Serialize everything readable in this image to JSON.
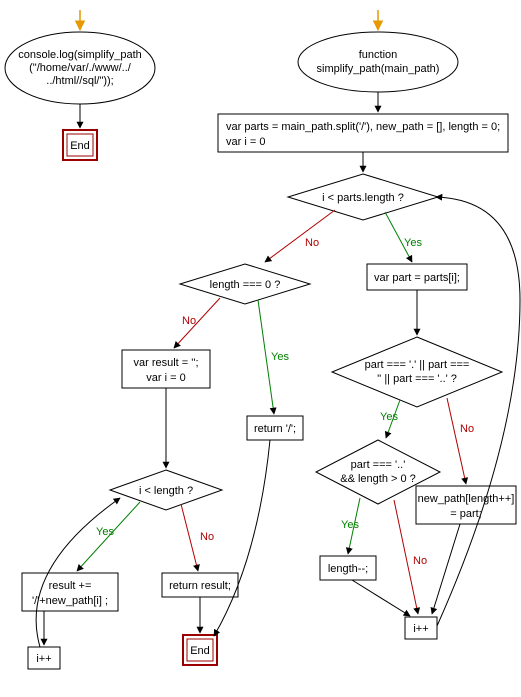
{
  "nodes": {
    "call_ellipse": {
      "line1": "console.log(simplify_path",
      "line2": "(\"/home/var/./www/../",
      "line3": "../html//sql/\"));"
    },
    "end1": "End",
    "func_ellipse": {
      "line1": "function",
      "line2": "simplify_path(main_path)"
    },
    "init_box": {
      "line1": "var parts = main_path.split('/'), new_path = [], length = 0;",
      "line2": "var i = 0"
    },
    "cond_i_parts": "i < parts.length ?",
    "cond_len0": "length === 0 ?",
    "box_part": "var part = parts[i];",
    "cond_part_dots": {
      "line1": "part === '.' || part ===",
      "line2": "'' || part === '..' ?"
    },
    "box_result": {
      "line1": "var result = '';",
      "line2": "var i = 0"
    },
    "ret_slash": "return '/';",
    "cond_part_up": {
      "line1": "part === '..'",
      "line2": "&& length > 0 ?"
    },
    "box_newpath": {
      "line1": "new_path[length++]",
      "line2": "= part;"
    },
    "cond_i_len": "i < length ?",
    "box_length_dec": "length--;",
    "box_result_app": {
      "line1": "result +=",
      "line2": "'/'+new_path[i] ;"
    },
    "ret_result": "return result;",
    "end2": "End",
    "ipp_left": "i++",
    "ipp_right": "i++"
  },
  "labels": {
    "yes": "Yes",
    "no": "No"
  }
}
